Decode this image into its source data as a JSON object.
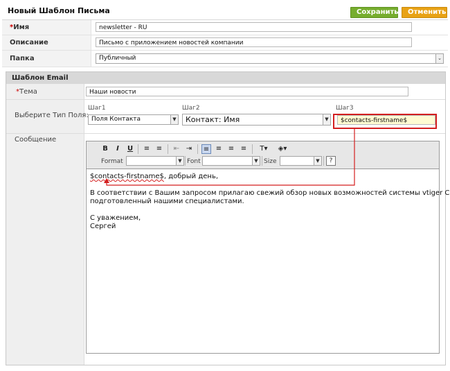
{
  "header": {
    "title": "Новый Шаблон Письма",
    "save_label": "Сохранить",
    "cancel_label": "Отменить",
    "save_color": "#76ad2e",
    "cancel_color": "#e8a215"
  },
  "fields": {
    "name": {
      "label": "Имя",
      "required_mark": "*",
      "value": "newsletter - RU"
    },
    "description": {
      "label": "Описание",
      "value": "Письмо с приложением новостей компании"
    },
    "folder": {
      "label": "Папка",
      "value": "Публичный"
    }
  },
  "email_template": {
    "section_title": "Шаблон Email",
    "subject": {
      "label": "Тема",
      "required_mark": "*",
      "value": "Наши новости"
    },
    "field_type": {
      "label": "Выберите Тип Поля:",
      "step1": {
        "label": "Шаг1",
        "value": "Поля Контакта"
      },
      "step2": {
        "label": "Шаг2",
        "value": "Контакт: Имя"
      },
      "step3": {
        "label": "Шаг3",
        "value": "$contacts-firstname$"
      }
    },
    "message": {
      "label": "Сообщение",
      "toolbar": {
        "bold": "B",
        "italic": "I",
        "underline": "U",
        "format_label": "Format",
        "font_label": "Font",
        "size_label": "Size",
        "help": "?"
      },
      "body": {
        "line1_var": "$contacts-firstname$",
        "line1_rest": ", добрый день,",
        "line2": "В соответствии с Вашим запросом прилагаю свежий обзор новых возможностей системы vtiger CRM,",
        "line3": "подготовленный нашими специалистами.",
        "line4": "С уважением,",
        "line5": "Сергей"
      }
    }
  },
  "annotation_color": "#d41f1f"
}
